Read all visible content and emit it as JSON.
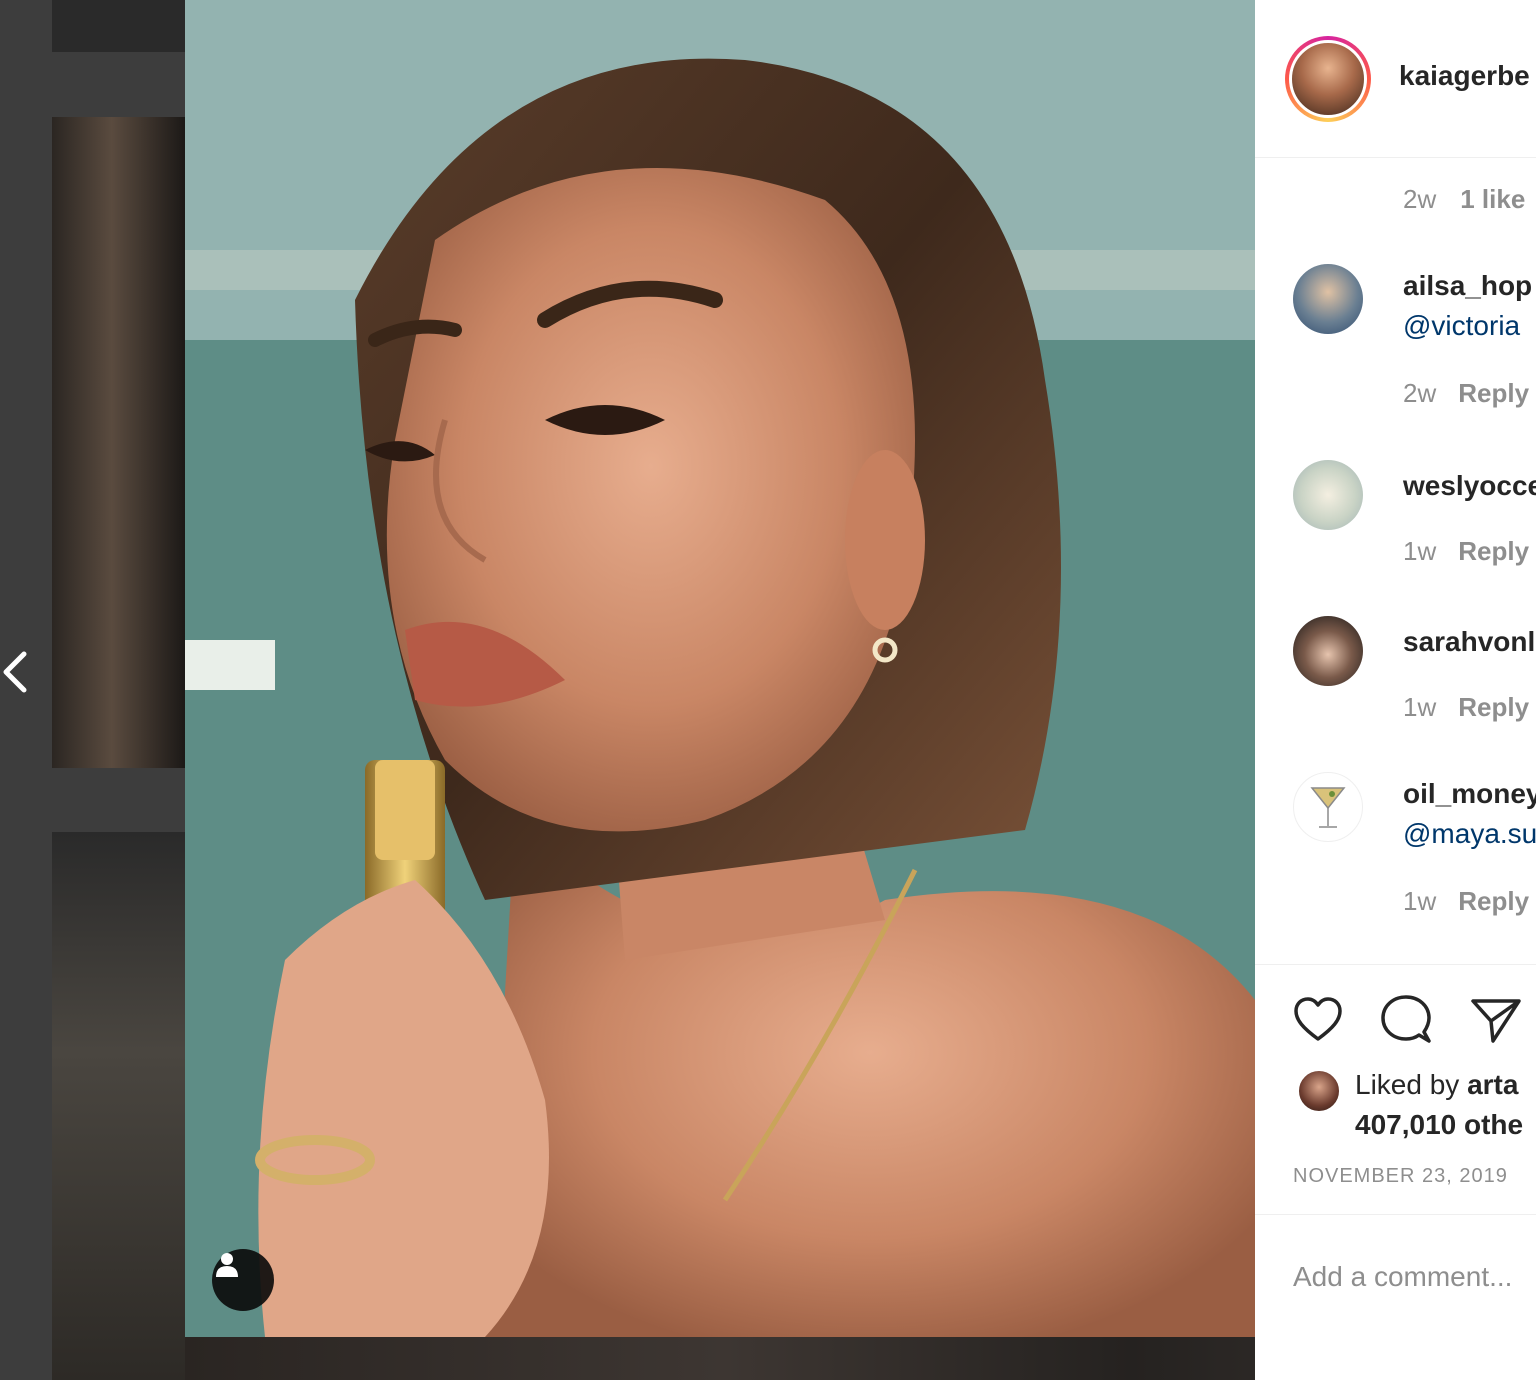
{
  "post": {
    "author": "kaiagerbe",
    "caption_meta": {
      "age": "2w",
      "likes": "1 like"
    }
  },
  "comments": [
    {
      "username": "ailsa_hop",
      "mention": "@victoria",
      "age": "2w",
      "reply": "Reply"
    },
    {
      "username": "weslyocce",
      "mention": "",
      "age": "1w",
      "reply": "Reply"
    },
    {
      "username": "sarahvonl",
      "mention": "",
      "age": "1w",
      "reply": "Reply"
    },
    {
      "username": "oil_money",
      "mention": "@maya.su",
      "age": "1w",
      "reply": "Reply"
    }
  ],
  "likes": {
    "prefix": "Liked by ",
    "user": "arta",
    "others": "407,010 othe"
  },
  "date": "NOVEMBER 23, 2019",
  "add_comment": {
    "placeholder": "Add a comment..."
  },
  "icons": [
    "chevron-left-icon",
    "user-tag-icon",
    "heart-icon",
    "comment-icon",
    "share-icon"
  ]
}
